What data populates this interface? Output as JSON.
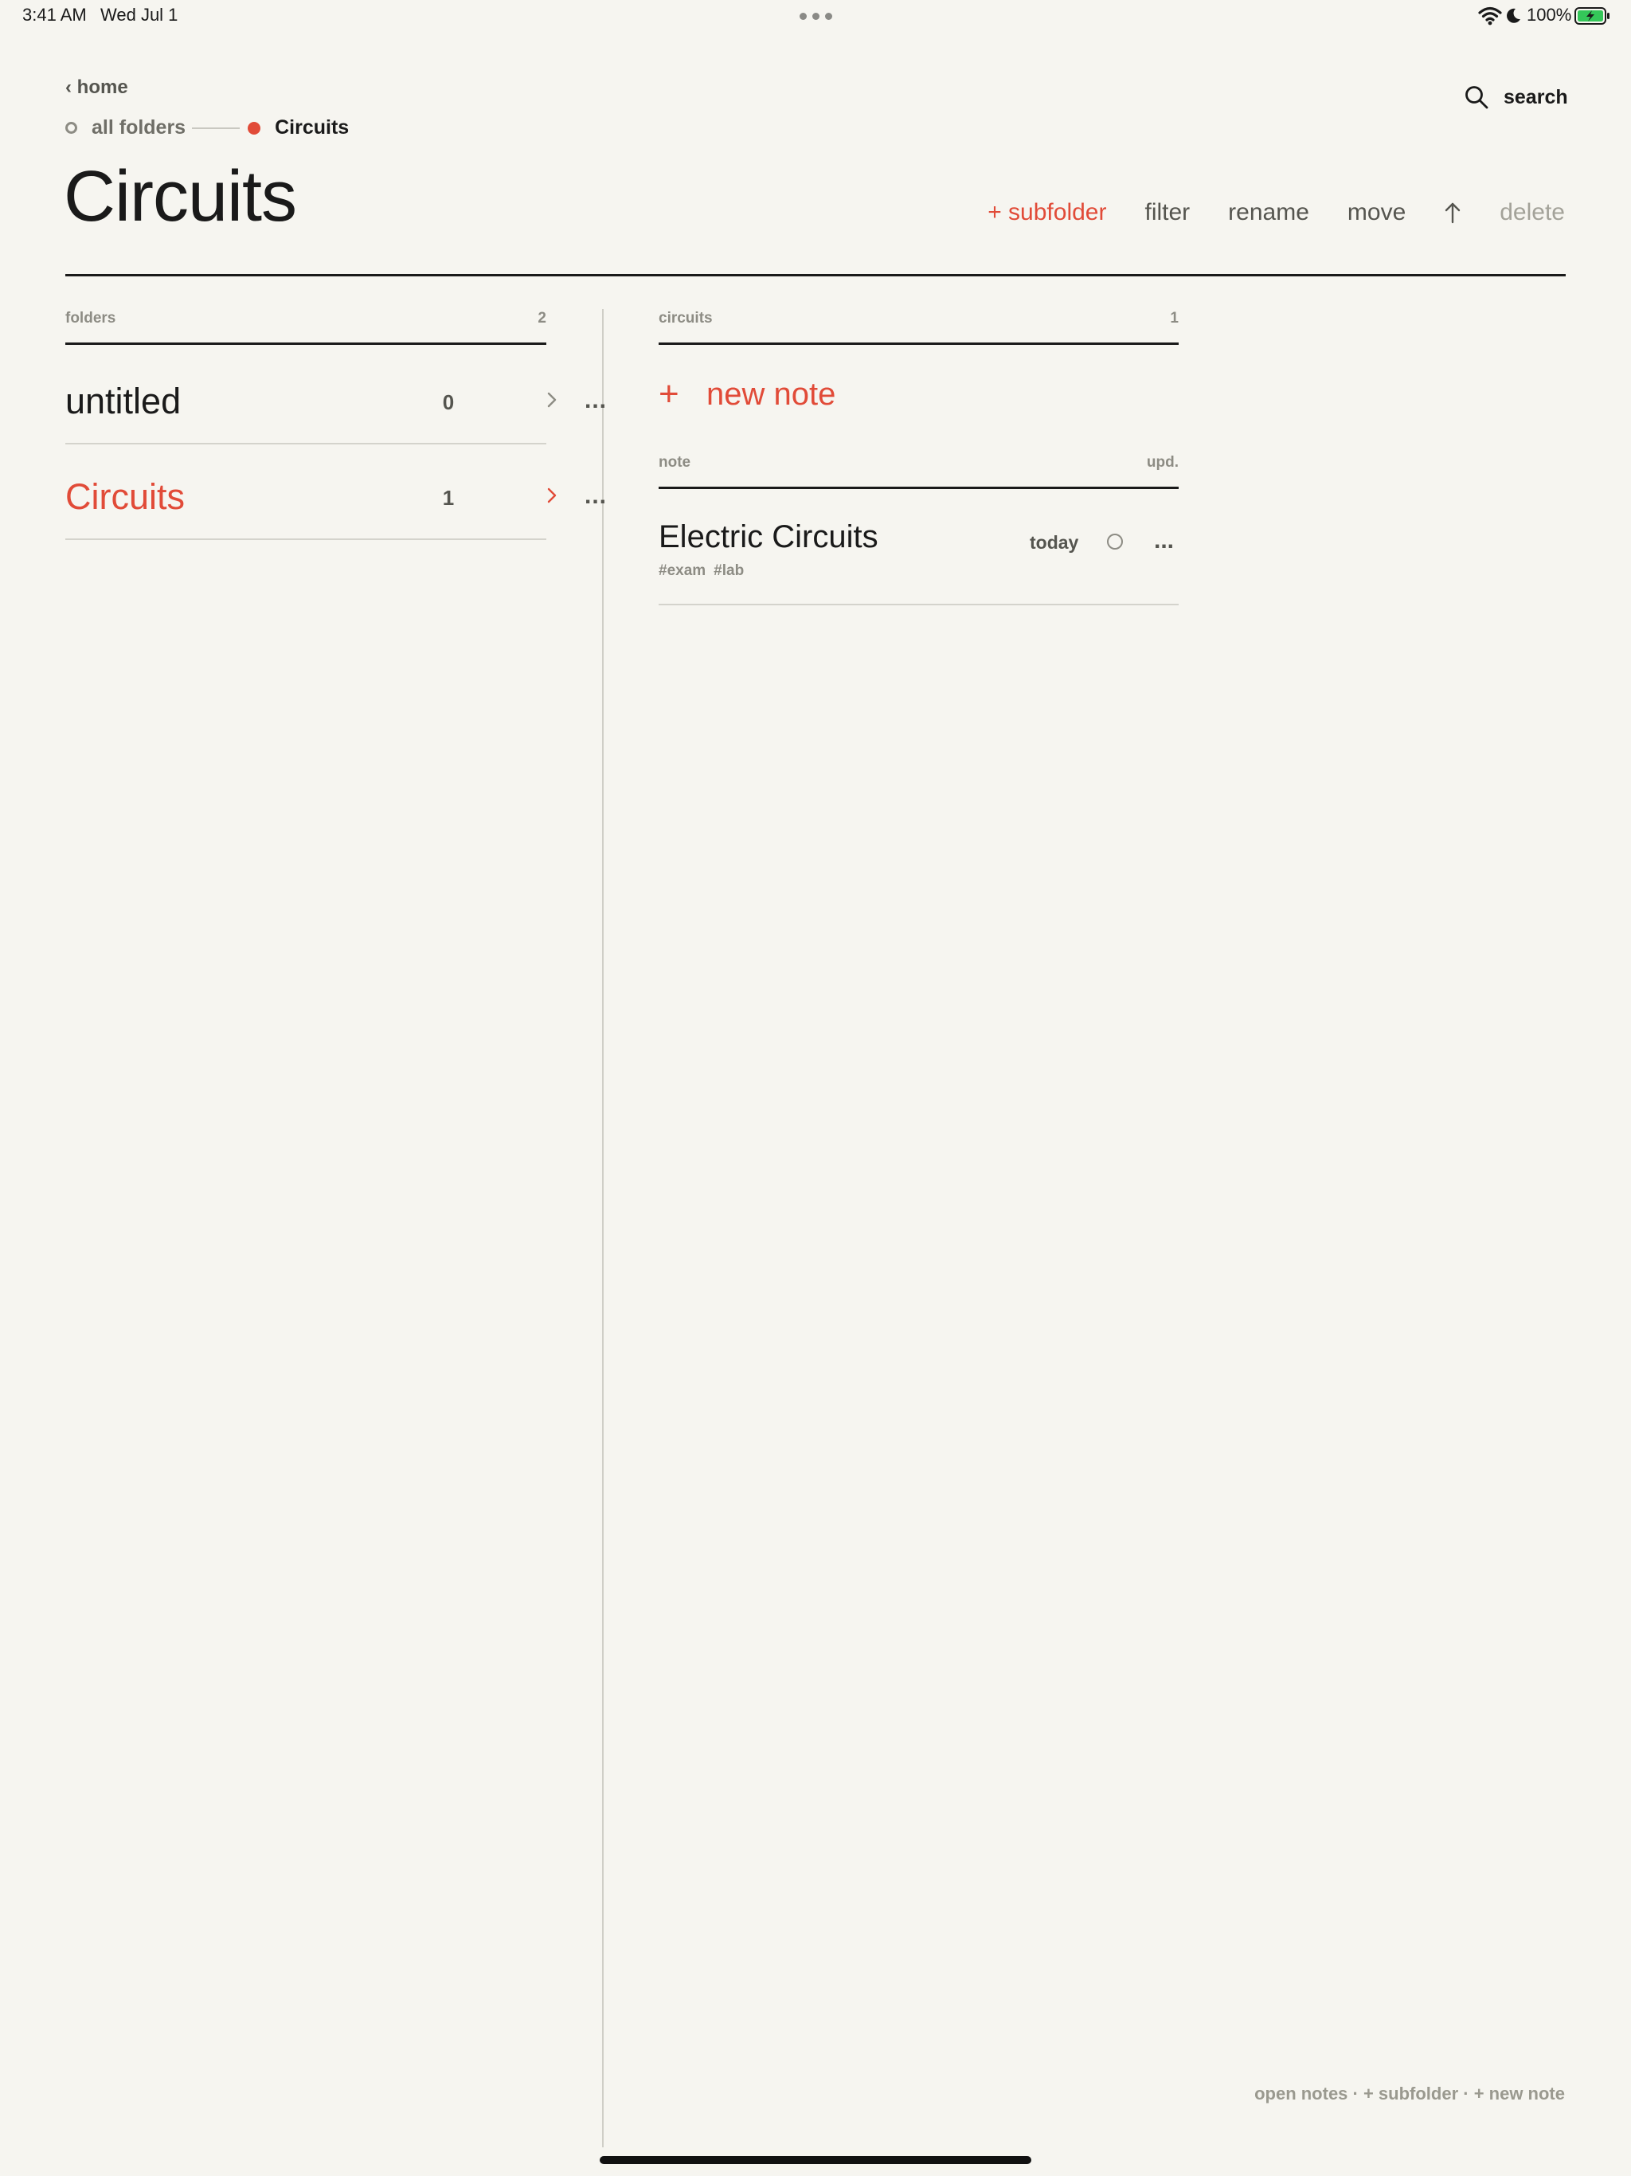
{
  "status_bar": {
    "time": "3:41 AM",
    "date": "Wed Jul 1",
    "battery": "100%"
  },
  "header": {
    "back_label": "‹ home",
    "breadcrumb": {
      "root": "all folders",
      "current": "Circuits"
    },
    "search_label": "search",
    "title": "Circuits",
    "actions": {
      "subfolder": "+ subfolder",
      "filter": "filter",
      "rename": "rename",
      "move": "move",
      "delete": "delete"
    }
  },
  "folders": {
    "label": "folders",
    "count": "2",
    "items": [
      {
        "name": "untitled",
        "count": "0",
        "more": "..."
      },
      {
        "name": "Circuits",
        "count": "1",
        "more": "..."
      }
    ]
  },
  "notes_pane": {
    "label": "circuits",
    "count": "1",
    "new_note_plus": "+",
    "new_note_label": "new note",
    "col_note": "note",
    "col_updated": "upd.",
    "items": [
      {
        "title": "Electric Circuits",
        "tags": [
          "#exam",
          "#lab"
        ],
        "updated": "today",
        "more": "..."
      }
    ]
  },
  "footer_hint": "open notes · + subfolder · + new note",
  "colors": {
    "accent": "#e14b38",
    "background": "#f6f5f0",
    "text": "#1a1a1a",
    "muted": "#8d8c84"
  }
}
